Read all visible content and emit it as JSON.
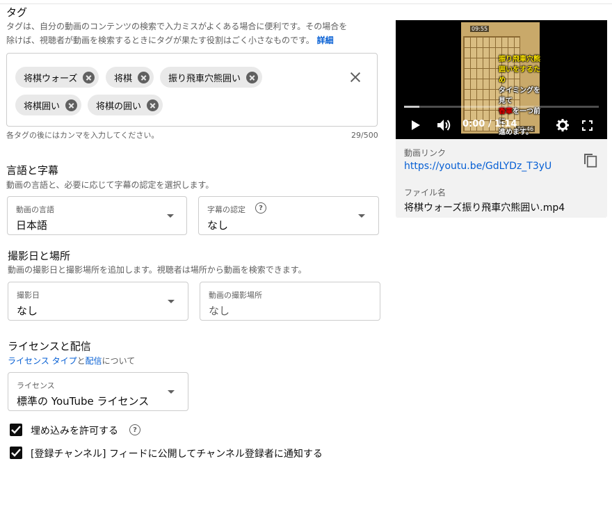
{
  "tags": {
    "title": "タグ",
    "desc_line1": "タグは、自分の動画のコンテンツの検索で入力ミスがよくある場合に便利です。その場合を",
    "desc_line2": "除けば、視聴者が動画を検索するときにタグが果たす役割はごく小さなものです。",
    "details_link": "詳細",
    "chips": [
      "将棋ウォーズ",
      "将棋",
      "振り飛車穴熊囲い",
      "将棋囲い",
      "将棋の囲い"
    ],
    "hint": "各タグの後にはカンマを入力してください。",
    "counter": "29/500"
  },
  "language": {
    "title": "言語と字幕",
    "desc": "動画の言語と、必要に応じて字幕の認定を選択します。",
    "video_language_label": "動画の言語",
    "video_language_value": "日本語",
    "caption_cert_label": "字幕の認定",
    "caption_cert_value": "なし"
  },
  "recording": {
    "title": "撮影日と場所",
    "desc": "動画の撮影日と撮影場所を追加します。視聴者は場所から動画を検索できます。",
    "date_label": "撮影日",
    "date_value": "なし",
    "location_label": "動画の撮影場所",
    "location_placeholder": "なし"
  },
  "license": {
    "title": "ライセンスと配信",
    "link_license_type": "ライセンス タイプ",
    "and": "と",
    "link_distribution": "配信",
    "about": "について",
    "license_label": "ライセンス",
    "license_value": "標準の YouTube ライセンス"
  },
  "checkboxes": {
    "allow_embedding": "埋め込みを許可する",
    "notify_subscribers": "[登録チャンネル] フィードに公開してチャンネル登録者に通知する"
  },
  "video": {
    "time": "0:00 / 1:14",
    "thumb_time_top": "09:55",
    "thumb_time_bottom": "00:46",
    "thumb_caption_1": "振り飛車穴熊",
    "thumb_caption_2": "囲いをするため",
    "thumb_caption_3": "タイミングを見て",
    "thumb_caption_4a": "香車",
    "thumb_caption_4b": "を一つ前に",
    "thumb_caption_5": "進めます。",
    "link_label": "動画リンク",
    "link_value": "https://youtu.be/GdLYDz_T3yU",
    "filename_label": "ファイル名",
    "filename_value": "将棋ウォーズ振り飛車穴熊囲い.mp4",
    "progress_fraction": 0.0
  },
  "icons": {
    "play": "play-icon",
    "volume": "volume-icon",
    "settings": "gear-icon",
    "fullscreen": "fullscreen-icon",
    "copy": "copy-icon",
    "help": "help-icon",
    "check": "check-icon",
    "clear": "close-icon",
    "dropdown": "caret-down-icon"
  },
  "colors": {
    "link": "#065fd4",
    "text": "#0d0d0d",
    "secondary": "#606060"
  }
}
